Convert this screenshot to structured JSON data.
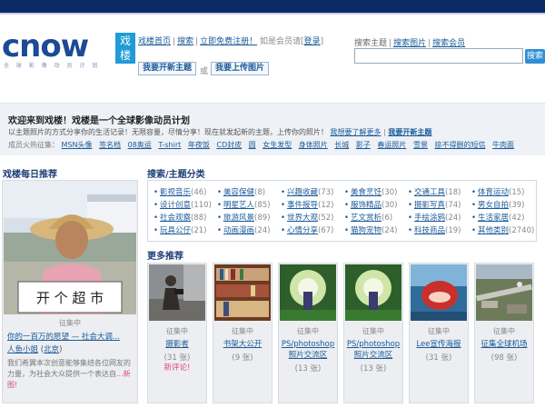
{
  "header": {
    "logo_word": "cnow",
    "logo_box": "戏楼",
    "logo_sub": "全 球 影 像 动 员 计 划",
    "nav": {
      "home": "戏楼首页",
      "search": "搜索",
      "register": "立即免费注册！",
      "member_q": "如是会员请",
      "login": "登录"
    },
    "start_topic": "我要开新主题",
    "or": "或",
    "upload": "我要上传图片"
  },
  "search": {
    "label": "搜索主题",
    "images": "搜索图片",
    "members": "搜索会员",
    "button": "搜索",
    "value": ""
  },
  "welcome": {
    "title": "欢迎来到戏楼！戏楼是一个全球影像动员计划",
    "line_text": "以主题照片的方式分享你的生活记录！无限容量，尽情分享！现在就发起新的主题，上传你的照片！",
    "learn_more": "我想要了解更多",
    "new_topic": "我要开新主题",
    "tags_label": "成员火热征集：",
    "tags": [
      "MSN头像",
      "签名档",
      "08奥运",
      "T-shirt",
      "年夜饭",
      "CD封皮",
      "圆",
      "女生发型",
      "身体照片",
      "长城",
      "影子",
      "春运照片",
      "雪景",
      "掠不得删的短信",
      "牛肉面"
    ]
  },
  "daily": {
    "heading": "戏楼每日推荐",
    "sign": "开 个 超 市",
    "caption": "征集中",
    "title": "你的一百万的愿望 — 社会大调...",
    "user": "人鱼小姐",
    "location": "北京",
    "desc": "我们希翼本次创意能够集结各位网友的力量，为社会大众提供一个表达自...",
    "new_label": "新图!"
  },
  "categories": {
    "heading": "搜索/主题分类",
    "items": [
      {
        "name": "影视音乐",
        "count": "(46)"
      },
      {
        "name": "美容保健",
        "count": "(8)"
      },
      {
        "name": "兴趣收藏",
        "count": "(73)"
      },
      {
        "name": "美食烹饪",
        "count": "(30)"
      },
      {
        "name": "交通工具",
        "count": "(18)"
      },
      {
        "name": "体育运动",
        "count": "(15)"
      },
      {
        "name": "设计创意",
        "count": "(110)"
      },
      {
        "name": "明星艺人",
        "count": "(85)"
      },
      {
        "name": "事件报导",
        "count": "(12)"
      },
      {
        "name": "服饰精品",
        "count": "(30)"
      },
      {
        "name": "摄影写真",
        "count": "(74)"
      },
      {
        "name": "男女自拍",
        "count": "(39)"
      },
      {
        "name": "社会观察",
        "count": "(88)"
      },
      {
        "name": "旅游风景",
        "count": "(89)"
      },
      {
        "name": "世界大观",
        "count": "(52)"
      },
      {
        "name": "艺文赏析",
        "count": "(6)"
      },
      {
        "name": "手绘涂鸦",
        "count": "(24)"
      },
      {
        "name": "生活家居",
        "count": "(42)"
      },
      {
        "name": "玩具公仔",
        "count": "(21)"
      },
      {
        "name": "动画漫画",
        "count": "(24)"
      },
      {
        "name": "心情分享",
        "count": "(67)"
      },
      {
        "name": "猫狗宠物",
        "count": "(24)"
      },
      {
        "name": "科技商品",
        "count": "(19)"
      },
      {
        "name": "其他类别",
        "count": "(2740)"
      }
    ]
  },
  "more": {
    "heading": "更多推荐",
    "cards": [
      {
        "caption": "征集中",
        "title": "摄影者",
        "count": "(31 张)",
        "new_label": "新评论!"
      },
      {
        "caption": "征集中",
        "title": "书架大公开",
        "count": "(9 张)",
        "new_label": ""
      },
      {
        "caption": "征集中",
        "title": "PS/photoshop照片交流区",
        "count": "(13 张)",
        "new_label": ""
      },
      {
        "caption": "征集中",
        "title": "PS/photoshop照片交流区",
        "count": "(13 张)",
        "new_label": ""
      },
      {
        "caption": "征集中",
        "title": "Lee宣传海报",
        "count": "(31 张)",
        "new_label": ""
      },
      {
        "caption": "征集中",
        "title": "征集全球机场",
        "count": "(98 张)",
        "new_label": ""
      }
    ]
  },
  "colors": {
    "topbar": "#0c2a66",
    "link": "#1a5b9a",
    "heading": "#1d3f76",
    "new": "#e04a7a",
    "search_button": "#2f8fd6"
  }
}
